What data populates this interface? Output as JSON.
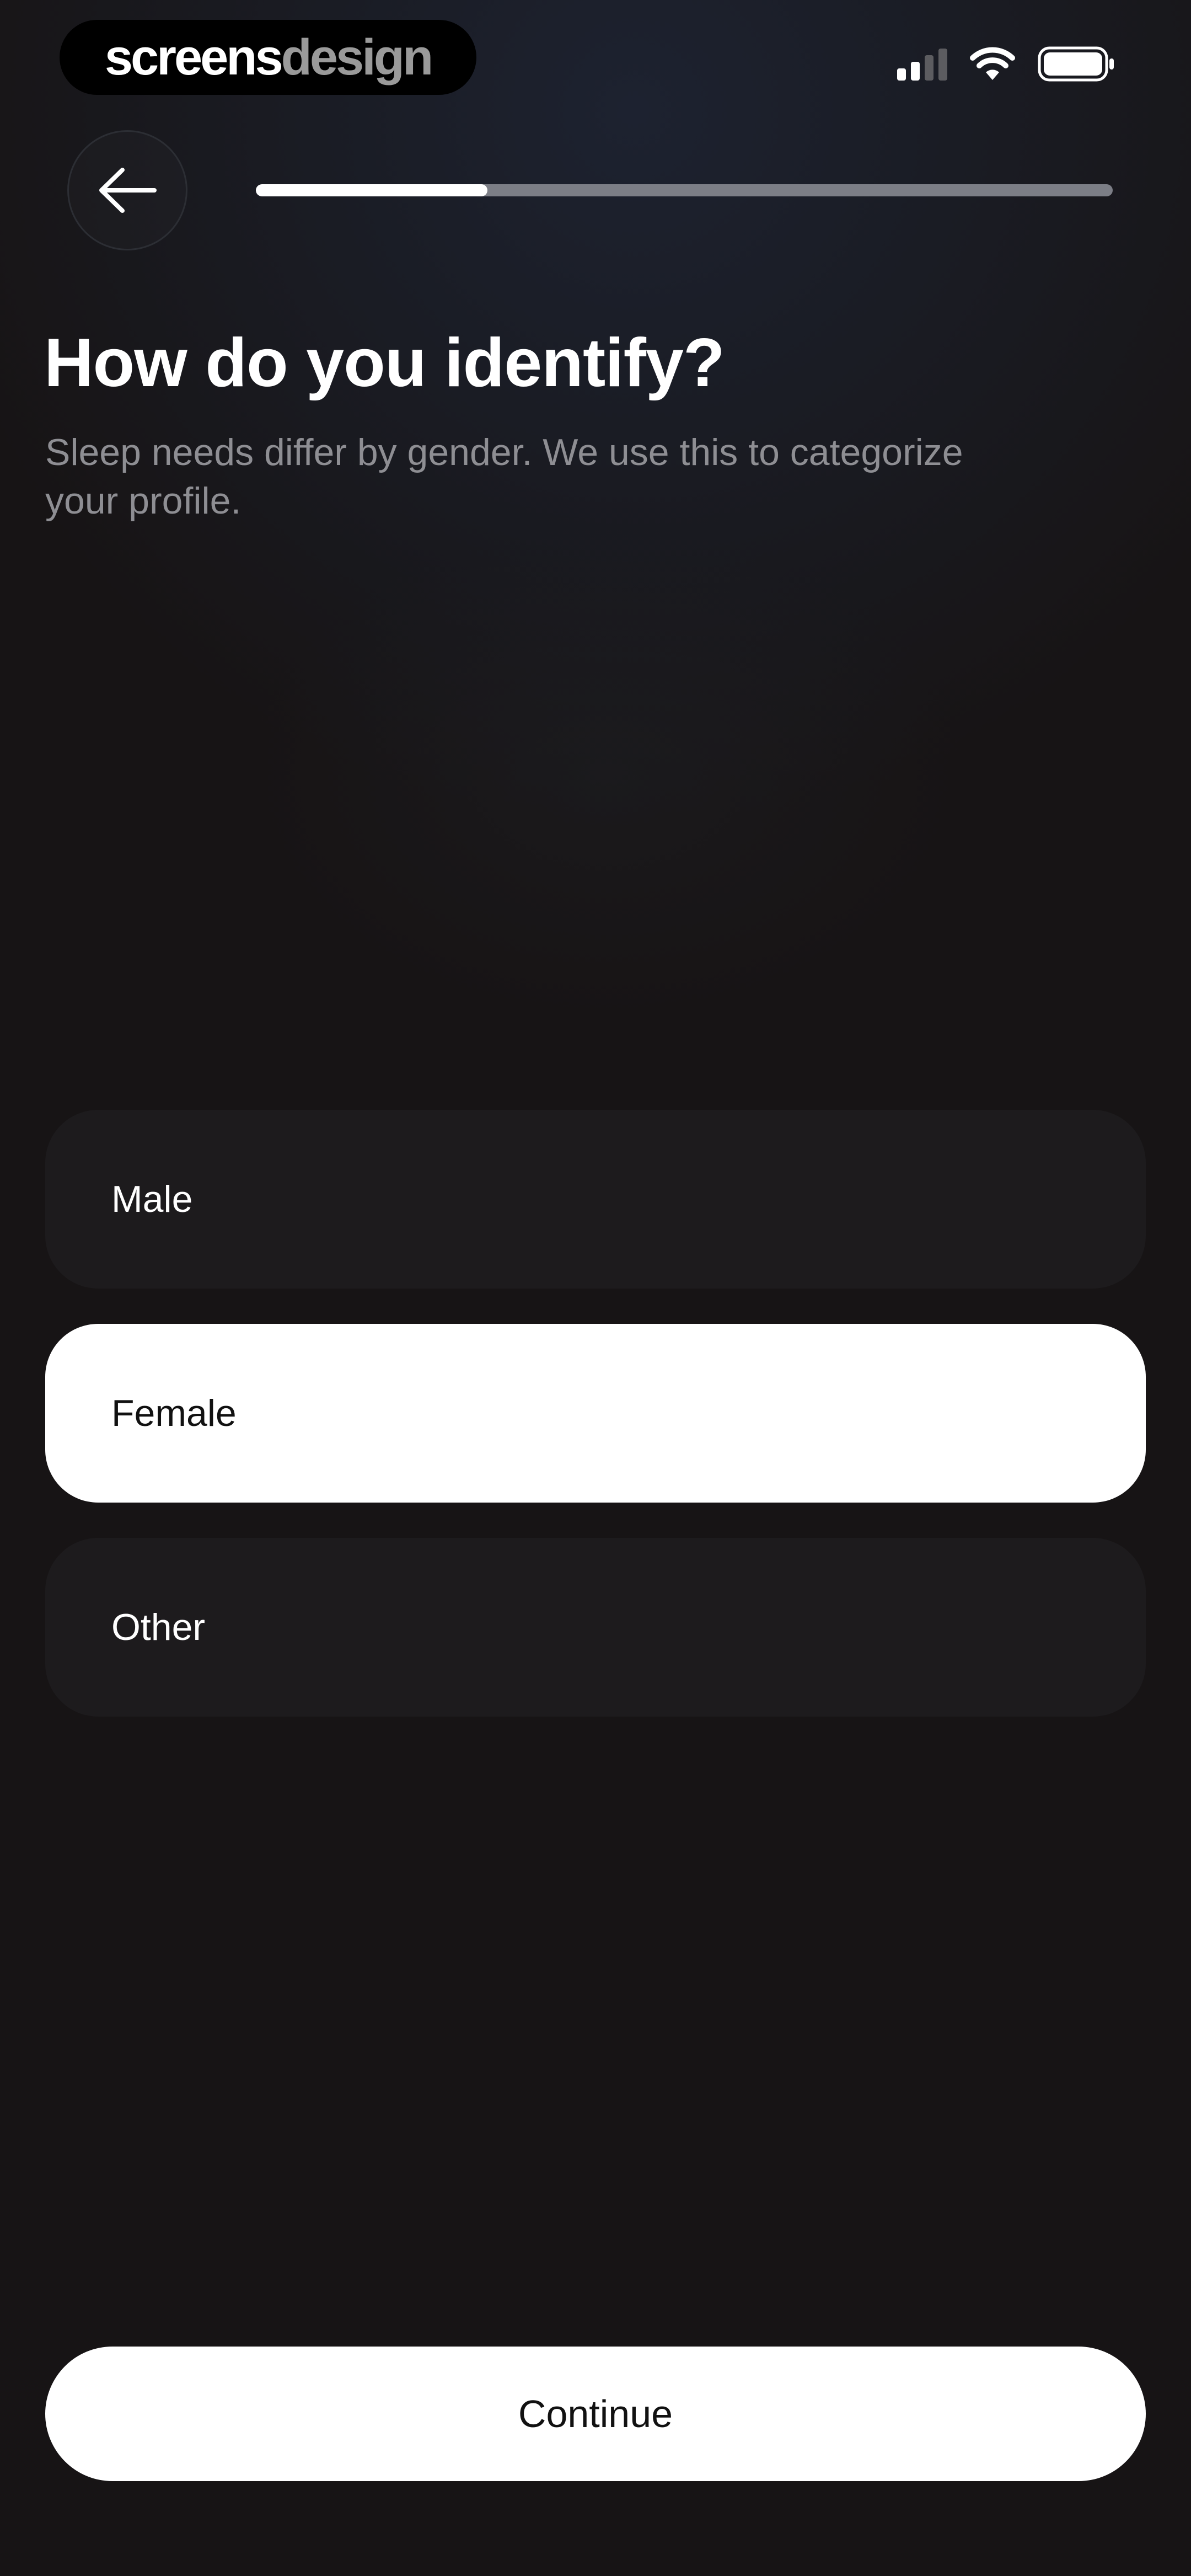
{
  "watermark": {
    "brand_part1": "screens",
    "brand_part2": "design"
  },
  "status_bar": {
    "signal_icon": "cellular-signal-icon",
    "wifi_icon": "wifi-icon",
    "battery_icon": "battery-icon"
  },
  "nav": {
    "back_icon": "arrow-left-icon",
    "progress": 0.27
  },
  "header": {
    "title": "How do you identify?",
    "subtitle": "Sleep needs differ by gender. We use this to categorize your profile."
  },
  "options": [
    {
      "label": "Male",
      "selected": false
    },
    {
      "label": "Female",
      "selected": true
    },
    {
      "label": "Other",
      "selected": false
    }
  ],
  "footer": {
    "continue_label": "Continue"
  },
  "colors": {
    "background": "#171415",
    "option_bg": "#1d1b1d",
    "selected_bg": "#ffffff",
    "progress_track": "#7c7e86",
    "progress_fill": "#ffffff",
    "subtitle": "#8e8e93"
  }
}
